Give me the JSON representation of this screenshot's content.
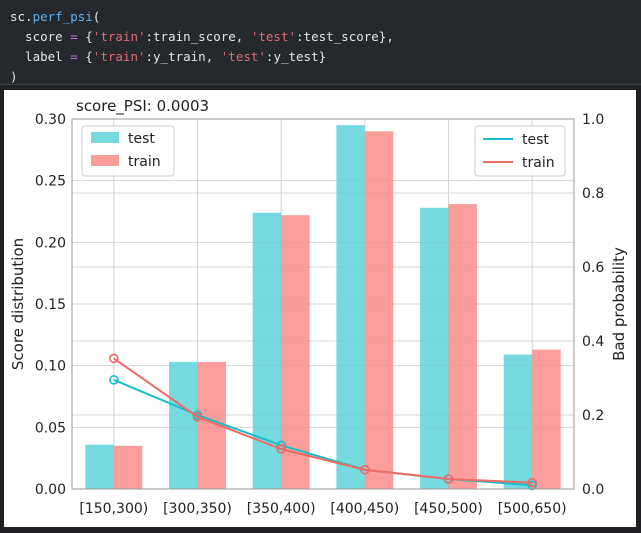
{
  "code": {
    "line1_obj": "sc.",
    "line1_fn": "perf_psi",
    "line1_paren": "(",
    "line2_a": "  score ",
    "line2_eq": "=",
    "line2_b": " {",
    "line2_s1": "'train'",
    "line2_c": ":train_score, ",
    "line2_s2": "'test'",
    "line2_d": ":test_score},",
    "line3_a": "  label ",
    "line3_eq": "=",
    "line3_b": " {",
    "line3_s1": "'train'",
    "line3_c": ":y_train, ",
    "line3_s2": "'test'",
    "line3_d": ":y_test}",
    "line4": ")"
  },
  "chart_data": {
    "type": "bar",
    "title": "score_PSI: 0.0003",
    "categories": [
      "[150,300)",
      "[300,350)",
      "[350,400)",
      "[400,450)",
      "[450,500)",
      "[500,650)"
    ],
    "ylabel": "Score distribution",
    "ylim": [
      0,
      0.3
    ],
    "yticks": [
      "0.00",
      "0.05",
      "0.10",
      "0.15",
      "0.20",
      "0.25",
      "0.30"
    ],
    "series": [
      {
        "name": "test",
        "color": "#5fd3d9",
        "values": [
          0.036,
          0.103,
          0.224,
          0.295,
          0.228,
          0.109
        ]
      },
      {
        "name": "train",
        "color": "#fa8c88",
        "values": [
          0.035,
          0.103,
          0.222,
          0.29,
          0.231,
          0.113
        ]
      }
    ],
    "y2label": "Bad probability",
    "y2lim": [
      0,
      1.0
    ],
    "y2ticks": [
      "0.0",
      "0.2",
      "0.4",
      "0.6",
      "0.8",
      "1.0"
    ],
    "line_series": [
      {
        "name": "test",
        "color": "#17becf",
        "values": [
          0.295,
          0.2,
          0.118,
          0.052,
          0.027,
          0.01
        ]
      },
      {
        "name": "train",
        "color": "#f06a62",
        "values": [
          0.353,
          0.195,
          0.108,
          0.052,
          0.027,
          0.017
        ]
      }
    ],
    "legend_bars": "top-left",
    "legend_lines": "top-right",
    "grid": true
  }
}
